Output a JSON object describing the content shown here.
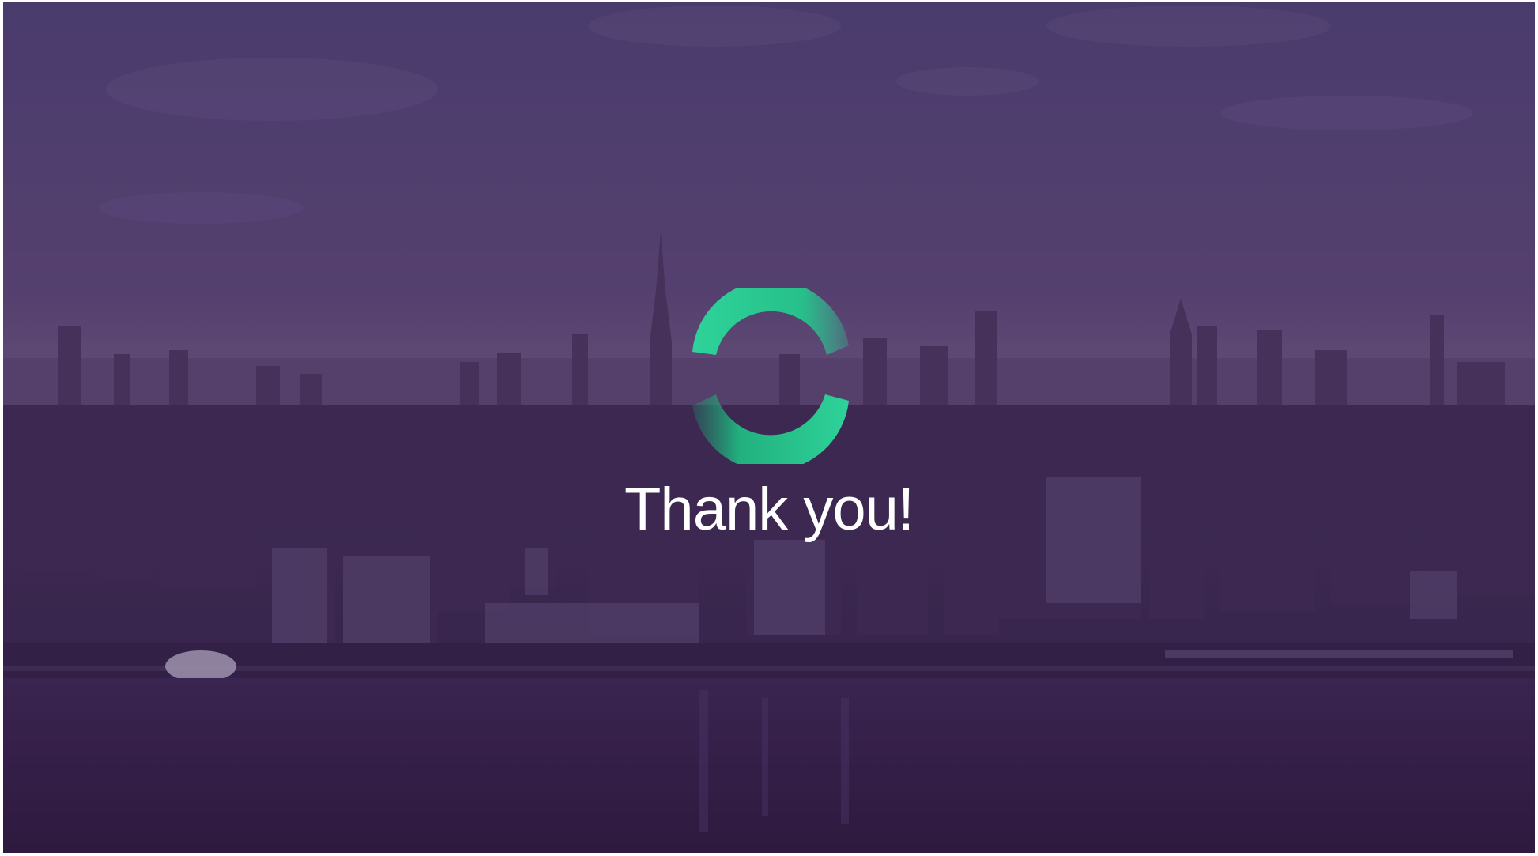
{
  "slide": {
    "title": "Thank you!",
    "background": "city-skyline-aerial-photo",
    "overlay_color": "#3d2352",
    "logo": "green-circular-arrows-logo",
    "logo_colors": [
      "#2ed39a",
      "#1fa875"
    ]
  }
}
